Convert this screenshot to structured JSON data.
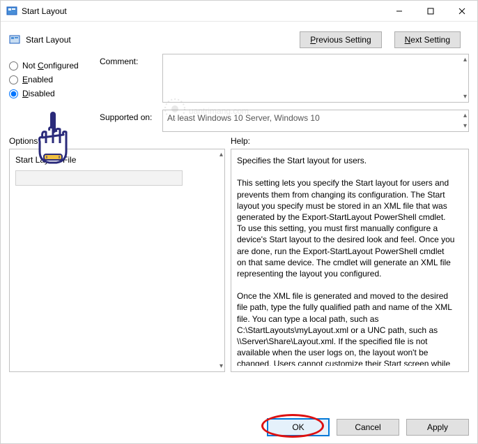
{
  "window": {
    "title": "Start Layout"
  },
  "header": {
    "setting_name": "Start Layout",
    "prev_btn": "Previous Setting",
    "next_btn": "Next Setting"
  },
  "state": {
    "not_configured": "Not Configured",
    "enabled": "Enabled",
    "disabled": "Disabled",
    "selected": "disabled"
  },
  "labels": {
    "comment": "Comment:",
    "supported_on": "Supported on:",
    "options": "Options:",
    "help": "Help:"
  },
  "supported_text": "At least Windows 10 Server, Windows 10",
  "options": {
    "file_label": "Start Layout File",
    "file_value": ""
  },
  "help_text": "Specifies the Start layout for users.\n\nThis setting lets you specify the Start layout for users and prevents them from changing its configuration. The Start layout you specify must be stored in an XML file that was generated by the Export-StartLayout PowerShell cmdlet.\nTo use this setting, you must first manually configure a device's Start layout to the desired look and feel. Once you are done, run the Export-StartLayout PowerShell cmdlet on that same device. The cmdlet will generate an XML file representing the layout you configured.\n\nOnce the XML file is generated and moved to the desired file path, type the fully qualified path and name of the XML file. You can type a local path, such as C:\\StartLayouts\\myLayout.xml or a UNC path, such as \\\\Server\\Share\\Layout.xml. If the specified file is not available when the user logs on, the layout won't be changed. Users cannot customize their Start screen while this setting is enabled.\n\nIf you disable this setting or do not configure it, the Start screen",
  "footer": {
    "ok": "OK",
    "cancel": "Cancel",
    "apply": "Apply"
  },
  "watermark": "Quantrimang.com"
}
